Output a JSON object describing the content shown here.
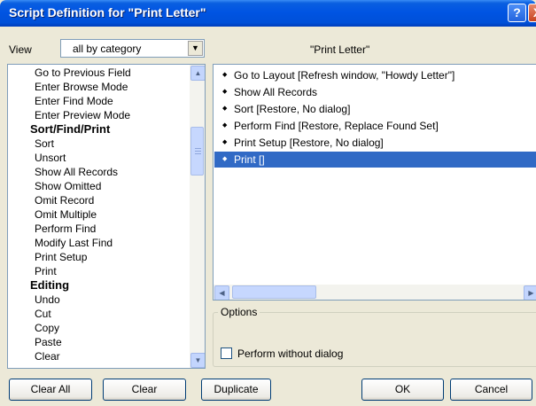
{
  "window": {
    "title": "Script Definition for \"Print Letter\""
  },
  "view": {
    "label": "View",
    "selected": "all by category"
  },
  "script_name": "\"Print Letter\"",
  "steps": [
    {
      "label": "Go to Previous Field",
      "category": false
    },
    {
      "label": "Enter Browse Mode",
      "category": false
    },
    {
      "label": "Enter Find Mode",
      "category": false
    },
    {
      "label": "Enter Preview Mode",
      "category": false
    },
    {
      "label": "Sort/Find/Print",
      "category": true
    },
    {
      "label": "Sort",
      "category": false
    },
    {
      "label": "Unsort",
      "category": false
    },
    {
      "label": "Show All Records",
      "category": false
    },
    {
      "label": "Show Omitted",
      "category": false
    },
    {
      "label": "Omit Record",
      "category": false
    },
    {
      "label": "Omit Multiple",
      "category": false
    },
    {
      "label": "Perform Find",
      "category": false
    },
    {
      "label": "Modify Last Find",
      "category": false
    },
    {
      "label": "Print Setup",
      "category": false
    },
    {
      "label": "Print",
      "category": false
    },
    {
      "label": "Editing",
      "category": true
    },
    {
      "label": "Undo",
      "category": false
    },
    {
      "label": "Cut",
      "category": false
    },
    {
      "label": "Copy",
      "category": false
    },
    {
      "label": "Paste",
      "category": false
    },
    {
      "label": "Clear",
      "category": false
    }
  ],
  "script_steps": [
    {
      "label": "Go to Layout [Refresh window, \"Howdy Letter\"]",
      "selected": false
    },
    {
      "label": "Show All Records",
      "selected": false
    },
    {
      "label": "Sort [Restore, No dialog]",
      "selected": false
    },
    {
      "label": "Perform Find [Restore, Replace Found Set]",
      "selected": false
    },
    {
      "label": "Print Setup [Restore, No dialog]",
      "selected": false
    },
    {
      "label": "Print []",
      "selected": true
    }
  ],
  "options": {
    "label": "Options",
    "checkbox_label": "Perform without dialog",
    "checked": false
  },
  "buttons": {
    "clear_all": "Clear All",
    "clear": "Clear",
    "duplicate": "Duplicate",
    "ok": "OK",
    "cancel": "Cancel"
  },
  "title_buttons": {
    "help": "?",
    "close": "X"
  }
}
